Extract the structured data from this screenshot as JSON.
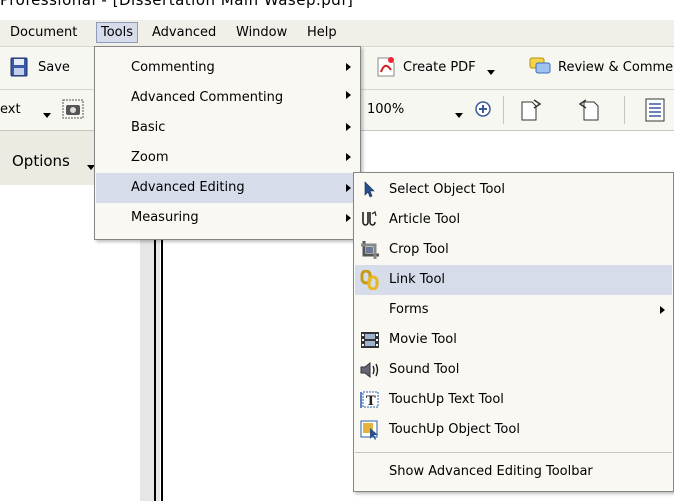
{
  "window": {
    "title": "Professional - [Dissertation Main Wasep.pdf]"
  },
  "menubar": {
    "items": [
      {
        "label": "Document"
      },
      {
        "label": "Tools"
      },
      {
        "label": "Advanced"
      },
      {
        "label": "Window"
      },
      {
        "label": "Help"
      }
    ]
  },
  "toolbar": {
    "save_label": "Save",
    "create_pdf_label": "Create PDF",
    "review_label": "Review & Comme",
    "text_tool_label": "ext",
    "zoom_value": "100%",
    "options_label": "Options"
  },
  "tools_menu": {
    "items": [
      {
        "label": "Commenting"
      },
      {
        "label": "Advanced Commenting"
      },
      {
        "label": "Basic"
      },
      {
        "label": "Zoom"
      },
      {
        "label": "Advanced Editing"
      },
      {
        "label": "Measuring"
      }
    ],
    "highlighted": "Advanced Editing"
  },
  "advanced_editing_menu": {
    "items": [
      {
        "label": "Select Object Tool",
        "icon": "arrow-cursor-icon"
      },
      {
        "label": "Article Tool",
        "icon": "article-tool-icon"
      },
      {
        "label": "Crop Tool",
        "icon": "crop-icon"
      },
      {
        "label": "Link Tool",
        "icon": "link-chain-icon"
      },
      {
        "label": "Forms",
        "icon": ""
      },
      {
        "label": "Movie Tool",
        "icon": "film-icon"
      },
      {
        "label": "Sound Tool",
        "icon": "speaker-icon"
      },
      {
        "label": "TouchUp Text Tool",
        "icon": "touchup-text-icon"
      },
      {
        "label": "TouchUp Object Tool",
        "icon": "touchup-object-icon"
      },
      {
        "label": "Show Advanced Editing Toolbar",
        "icon": ""
      }
    ],
    "highlighted": "Link Tool"
  },
  "colors": {
    "menu_bg": "#f9f8f3",
    "highlight": "#d6dcea",
    "toolbar_bg": "#f7f7f2"
  }
}
